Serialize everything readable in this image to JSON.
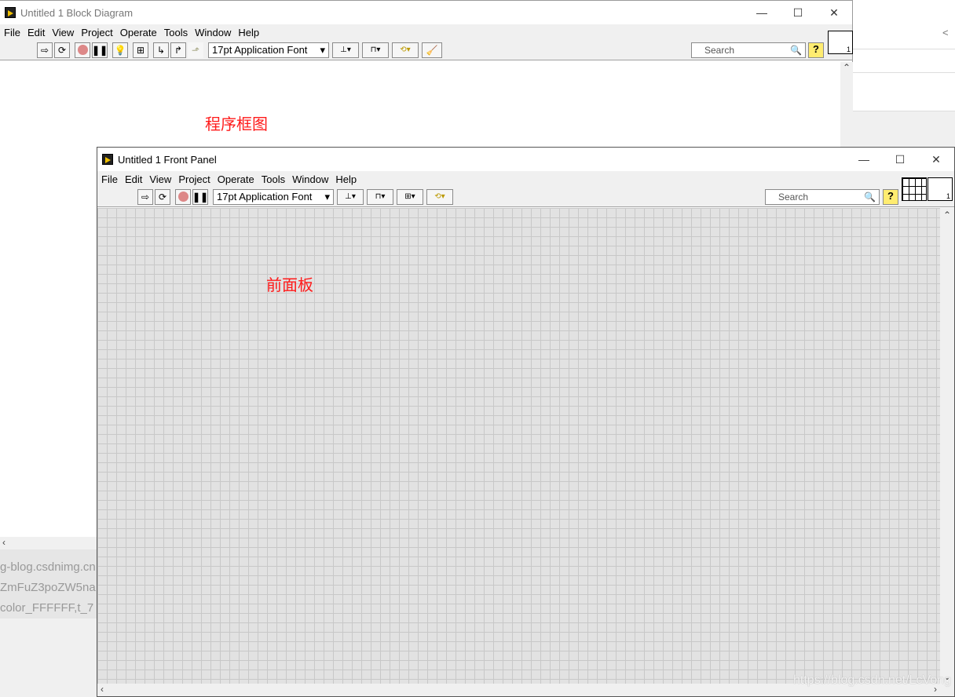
{
  "background": {
    "lines": [
      "g-blog.csdnimg.cn",
      "ZmFuZ3poZW5na",
      "color_FFFFFF,t_7"
    ],
    "watermark": "https://blog.csdn.net/LcVong"
  },
  "block_diagram": {
    "title": "Untitled 1 Block Diagram",
    "menu": [
      "File",
      "Edit",
      "View",
      "Project",
      "Operate",
      "Tools",
      "Window",
      "Help"
    ],
    "font": "17pt Application Font",
    "search_placeholder": "Search",
    "annotation": "程序框图",
    "icon_number": "1"
  },
  "front_panel": {
    "title": "Untitled 1 Front Panel",
    "menu": [
      "File",
      "Edit",
      "View",
      "Project",
      "Operate",
      "Tools",
      "Window",
      "Help"
    ],
    "font": "17pt Application Font",
    "search_placeholder": "Search",
    "annotation": "前面板",
    "icon_number": "1"
  },
  "colors": {
    "annotation": "#ff1a1a",
    "panel_grid": "#e2e2e2"
  }
}
